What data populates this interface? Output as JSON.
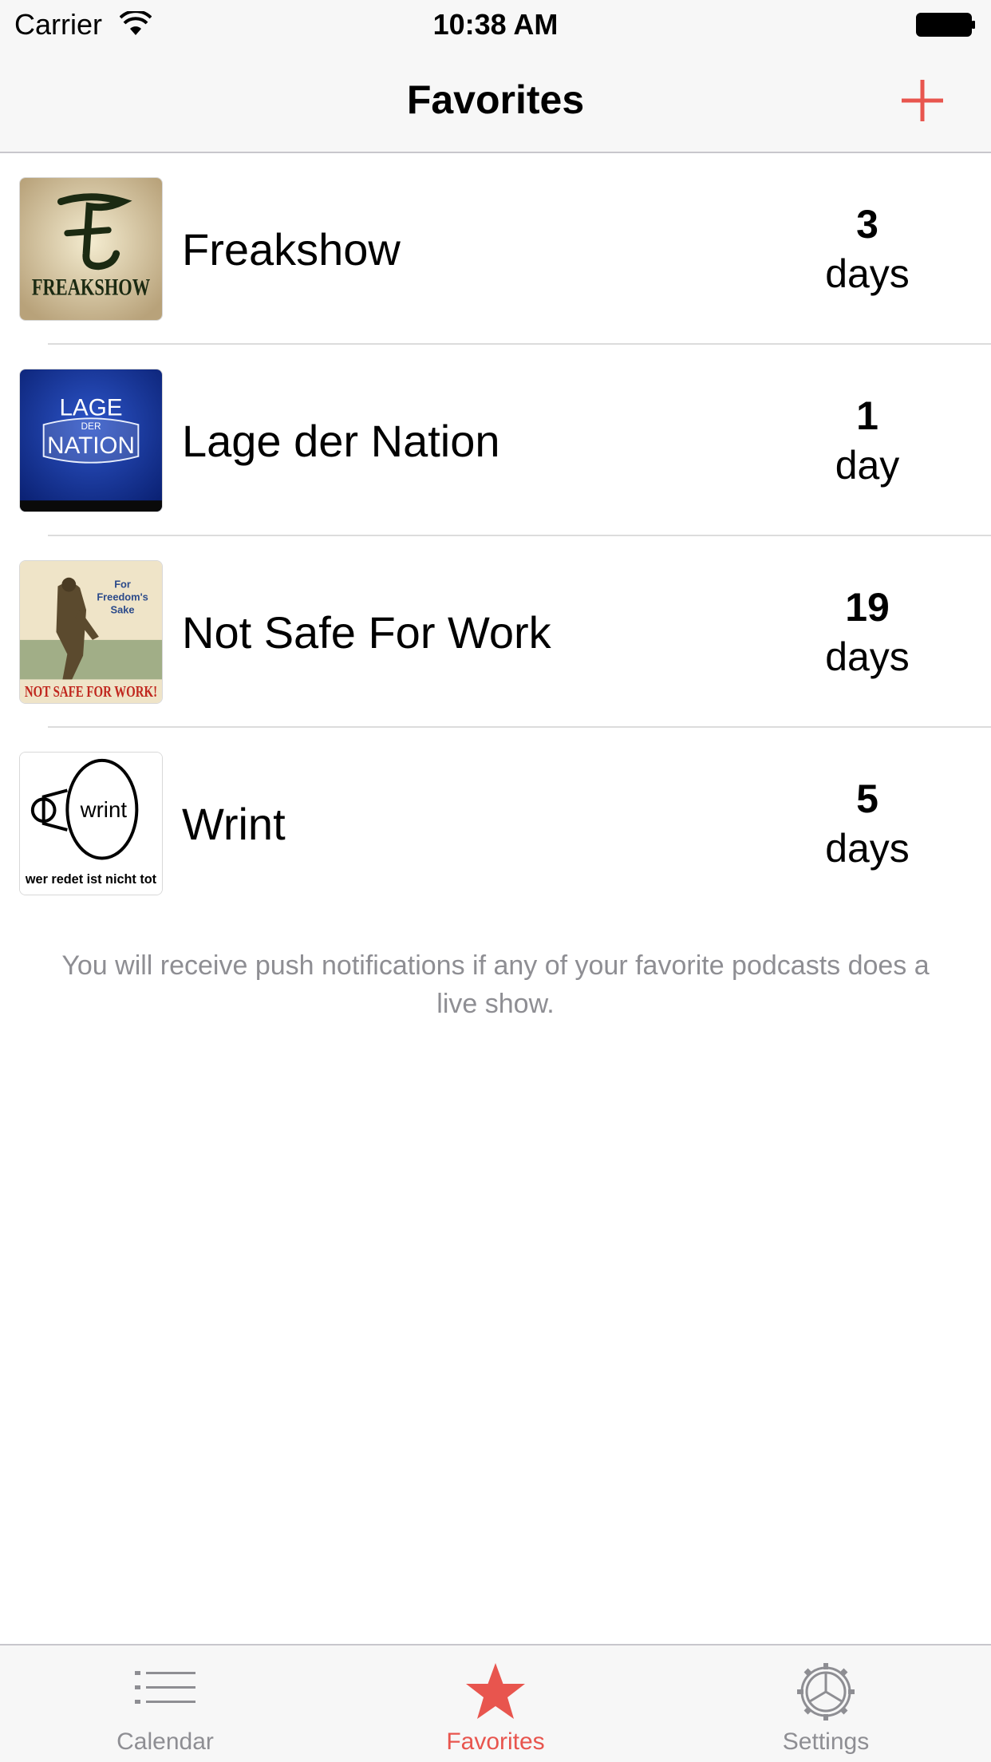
{
  "status_bar": {
    "carrier": "Carrier",
    "time": "10:38 AM"
  },
  "nav": {
    "title": "Favorites",
    "add_icon": "plus-icon"
  },
  "colors": {
    "accent": "#e8554e",
    "separator": "#dcdcdc",
    "bar_background": "#f7f7f7",
    "secondary_text": "#8e8e93"
  },
  "favorites": [
    {
      "title": "Freakshow",
      "count": "3",
      "unit": "days",
      "artwork_text": "FREAKSHOW"
    },
    {
      "title": "Lage der Nation",
      "count": "1",
      "unit": "day",
      "artwork_text": "LAGE DER NATION"
    },
    {
      "title": "Not Safe For Work",
      "count": "19",
      "unit": "days",
      "artwork_text": "NOT SAFE FOR WORK!"
    },
    {
      "title": "Wrint",
      "count": "5",
      "unit": "days",
      "artwork_text": "wer redet ist nicht tot"
    }
  ],
  "footer_note": "You will receive push notifications if any of your favorite podcasts does a live show.",
  "tabs": [
    {
      "label": "Calendar",
      "icon": "list-icon",
      "active": false
    },
    {
      "label": "Favorites",
      "icon": "star-icon",
      "active": true
    },
    {
      "label": "Settings",
      "icon": "gear-icon",
      "active": false
    }
  ]
}
